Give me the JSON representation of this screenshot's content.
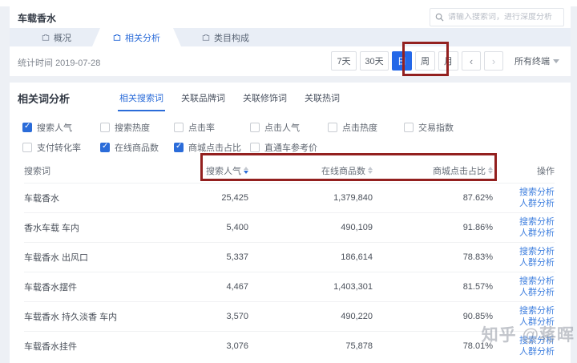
{
  "page": {
    "title": "车载香水",
    "watermark": "知乎 @蒋晖"
  },
  "search": {
    "placeholder": "请输入搜索词，进行深度分析",
    "icon": "magnifier"
  },
  "main_tabs": [
    {
      "label": "概况",
      "active": false
    },
    {
      "label": "相关分析",
      "active": true
    },
    {
      "label": "类目构成",
      "active": false
    }
  ],
  "stats": {
    "time_label": "统计时间",
    "date": "2019-07-28",
    "range_buttons": {
      "d7": "7天",
      "d30": "30天",
      "day": "日",
      "week": "周",
      "month": "月"
    },
    "selected_range": "日",
    "prev": "‹",
    "next": "›",
    "terminal_label": "所有终端"
  },
  "section": {
    "title": "相关词分析",
    "tabs": [
      {
        "label": "相关搜索词",
        "active": true
      },
      {
        "label": "关联品牌词",
        "active": false
      },
      {
        "label": "关联修饰词",
        "active": false
      },
      {
        "label": "关联热词",
        "active": false
      }
    ],
    "metrics_row1": [
      {
        "label": "搜索人气",
        "checked": true
      },
      {
        "label": "搜索热度",
        "checked": false
      },
      {
        "label": "点击率",
        "checked": false
      },
      {
        "label": "点击人气",
        "checked": false
      },
      {
        "label": "点击热度",
        "checked": false
      },
      {
        "label": "交易指数",
        "checked": false
      }
    ],
    "metrics_row2": [
      {
        "label": "支付转化率",
        "checked": false
      },
      {
        "label": "在线商品数",
        "checked": true
      },
      {
        "label": "商城点击占比",
        "checked": true
      },
      {
        "label": "直通车参考价",
        "checked": false
      }
    ]
  },
  "table": {
    "columns": {
      "keyword": "搜索词",
      "search_popularity": "搜索人气",
      "online_products": "在线商品数",
      "mall_click_ratio": "商城点击占比",
      "actions": "操作"
    },
    "sort": {
      "column": "搜索人气",
      "direction": "desc"
    },
    "actions": {
      "search_analysis": "搜索分析",
      "crowd_analysis": "人群分析"
    },
    "rows": [
      {
        "keyword": "车载香水",
        "search_popularity": "25,425",
        "online_products": "1,379,840",
        "mall_click_ratio": "87.62%"
      },
      {
        "keyword": "香水车载 车内",
        "search_popularity": "5,400",
        "online_products": "490,109",
        "mall_click_ratio": "91.86%"
      },
      {
        "keyword": "车载香水 出风口",
        "search_popularity": "5,337",
        "online_products": "186,614",
        "mall_click_ratio": "78.83%"
      },
      {
        "keyword": "车载香水摆件",
        "search_popularity": "4,467",
        "online_products": "1,403,301",
        "mall_click_ratio": "81.57%"
      },
      {
        "keyword": "车载香水 持久淡香 车内",
        "search_popularity": "3,570",
        "online_products": "490,220",
        "mall_click_ratio": "90.85%"
      },
      {
        "keyword": "车载香水挂件",
        "search_popularity": "3,076",
        "online_products": "75,878",
        "mall_click_ratio": "78.01%"
      }
    ]
  },
  "colors": {
    "accent_blue": "#2b6cd9",
    "selected_button_blue": "#2468e8",
    "annotation_red": "#93201f",
    "tab_strip_bg": "#e9eef6",
    "page_bg": "#edf0f5"
  },
  "icons": {
    "search": "magnifier-icon",
    "main_tab": "briefcase-icon",
    "sort": "caret-up-down-icon",
    "dropdown": "caret-down-icon"
  }
}
